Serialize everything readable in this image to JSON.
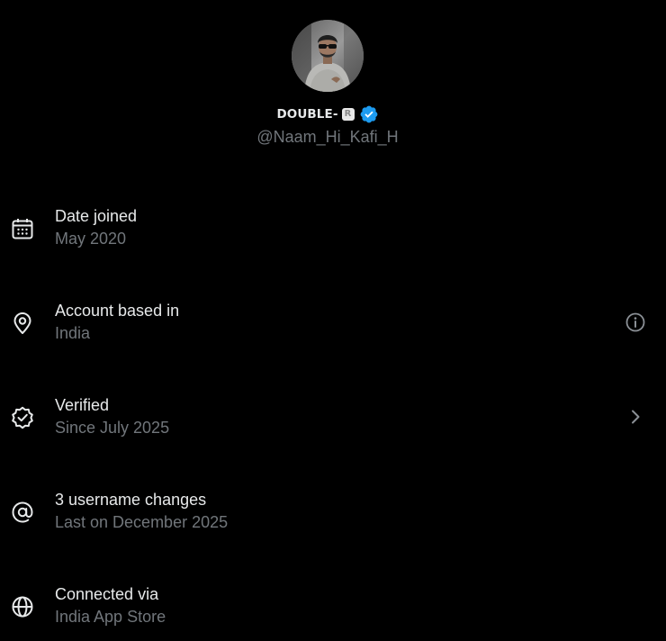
{
  "profile": {
    "display_name": "DOUBLE-",
    "name_badge": "R",
    "handle": "@Naam_Hi_Kafi_H",
    "verified_color": "#1d9bf0",
    "avatar_icon": "profile-photo"
  },
  "details": {
    "rows": [
      {
        "title": "Date joined",
        "subtitle": "May 2020",
        "icon": "calendar-icon",
        "trailing": ""
      },
      {
        "title": "Account based in",
        "subtitle": "India",
        "icon": "location-pin-icon",
        "trailing": "info-icon"
      },
      {
        "title": "Verified",
        "subtitle": "Since July 2025",
        "icon": "verified-check-icon",
        "trailing": "chevron-right-icon"
      },
      {
        "title": "3 username changes",
        "subtitle": "Last on December 2025",
        "icon": "at-sign-icon",
        "trailing": ""
      },
      {
        "title": "Connected via",
        "subtitle": "India App Store",
        "icon": "globe-icon",
        "trailing": ""
      }
    ]
  },
  "colors": {
    "background": "#000000",
    "primary_text": "#e7e9ea",
    "secondary_text": "#71767b",
    "accent": "#1d9bf0"
  }
}
